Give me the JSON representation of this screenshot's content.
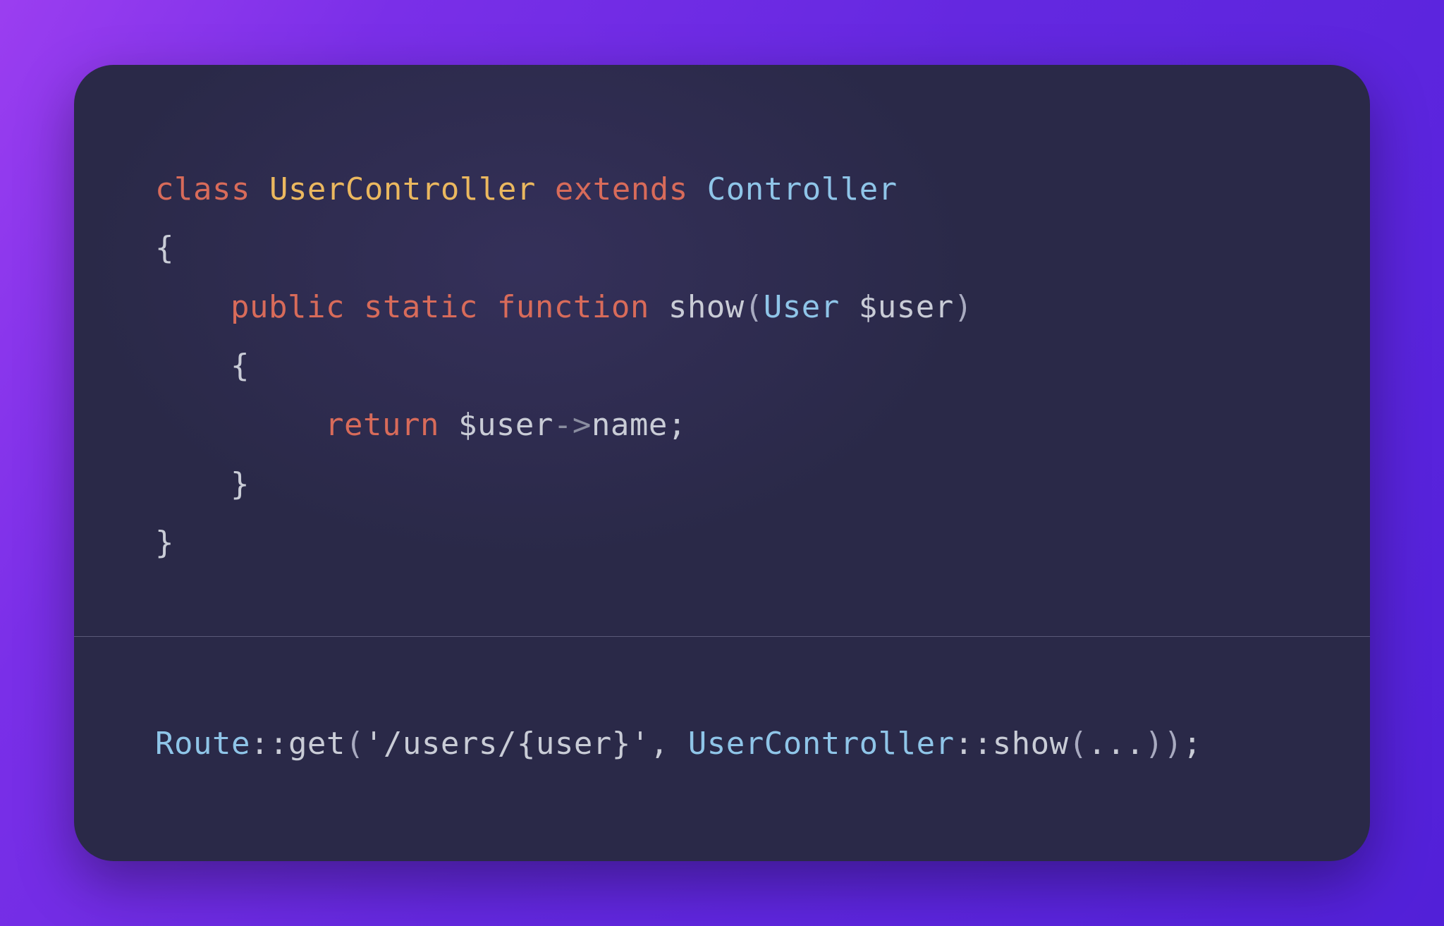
{
  "code_top": {
    "line1": {
      "class_kw": "class",
      "class_name": "UserController",
      "extends_kw": "extends",
      "parent_name": "Controller"
    },
    "line2": {
      "open_brace": "{"
    },
    "line3": {
      "public_kw": "public",
      "static_kw": "static",
      "function_kw": "function",
      "fn_name": "show",
      "open_paren": "(",
      "param_type": "User",
      "param_var": "$user",
      "close_paren": ")"
    },
    "line4": {
      "open_brace": "{"
    },
    "line5": {
      "return_kw": "return",
      "var": "$user",
      "arrow": "->",
      "prop": "name",
      "semicolon": ";"
    },
    "line6": {
      "close_brace": "}"
    },
    "line7": {
      "close_brace": "}"
    }
  },
  "code_bottom": {
    "line1": {
      "route_class": "Route",
      "scope_op": "::",
      "method": "get",
      "open_paren": "(",
      "path_string": "'/users/{user}'",
      "comma": ", ",
      "controller_class": "UserController",
      "scope_op2": "::",
      "method2": "show",
      "open_paren2": "(",
      "dots": "...",
      "close_paren2": ")",
      "close_paren": ")",
      "semicolon": ";"
    }
  },
  "colors": {
    "bg_gradient_start": "#9b3ef0",
    "bg_gradient_end": "#5220d8",
    "card_bg": "#2a2948",
    "keyword": "#d86b5a",
    "classname": "#ebb85f",
    "type": "#8fc5e8",
    "default": "#c9ccd6",
    "punct": "#8a8da0",
    "divider": "#5a5978"
  }
}
